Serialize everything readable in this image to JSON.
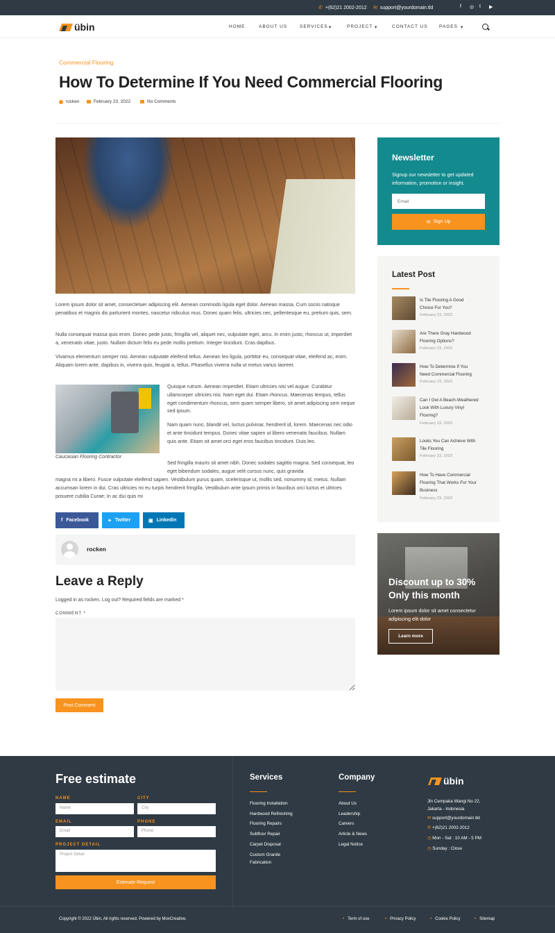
{
  "topbar": {
    "phone": "+(62)21 2002-2012",
    "email": "support@yourdomain.tld",
    "social": [
      "f",
      "◎",
      "t",
      "▶"
    ]
  },
  "nav": {
    "logo": "übin",
    "items": [
      "HOME",
      "ABOUT US",
      "SERVICES",
      "PROJECT",
      "CONTACT US",
      "PAGES"
    ]
  },
  "post": {
    "category": "Commercial Flooring",
    "title": "How To Determine If You Need Commercial Flooring",
    "author": "rocken",
    "date": "February 23, 2022",
    "comments": "No Comments",
    "p1": "Lorem ipsum dolor sit amet, consectetuer adipiscing elit. Aenean commodo ligula eget dolor. Aenean massa. Cum sociis natoque penatibus et magnis dis parturient montes, nascetur ridiculus mus. Donec quam felis, ultricies nec, pellentesque eu, pretium quis, sem.",
    "p2": "Nulla consequat massa quis enim. Donec pede justo, fringilla vel, aliquet nec, vulputate eget, arcu. In enim justo, rhoncus ut, imperdiet a, venenatis vitae, justo. Nullam dictum felis eu pede mollis pretium. Integer tincidunt. Cras dapibus.",
    "p3": "Vivamus elementum semper nisi. Aenean vulputate eleifend tellus. Aenean leo ligula, porttitor eu, consequat vitae, eleifend ac, enim. Aliquam lorem ante, dapibus in, viverra quis, feugiat a, tellus. Phasellus viverra nulla ut metus varius laoreet.",
    "p4": "Quisque rutrum. Aenean imperdiet. Etiam ultricies nisi vel augue. Curabitur ullamcorper ultricies nisi. Nam eget dui. Etiam rhoncus. Maecenas tempus, tellus eget condimentum rhoncus, sem quam semper libero, sit amet adipiscing sem neque sed ipsum.",
    "p5": "Nam quam nunc, blandit vel, luctus pulvinar, hendrerit id, lorem. Maecenas nec odio et ante tincidunt tempus. Donec vitae sapien ut libero venenatis faucibus. Nullam quis ante. Etiam sit amet orci eget eros faucibus tincidunt. Duis leo.",
    "p6a": "Sed fringilla mauris sit amet nibh. Donec sodales sagittis magna. Sed consequat, leo eget bibendum sodales, augue velit cursus nunc, quis gravida",
    "p6b": "magna mi a libero. Fusce vulputate eleifend sapien. Vestibulum purus quam, scelerisque ut, mollis sed, nonummy id, metus. Nullam accumsan lorem in dui. Cras ultricies mi eu turpis hendrerit fringilla. Vestibulum ante ipsum primis in faucibus orci luctus et ultrices posuere cubilia Curae; In ac dui quis mi",
    "caption": "Caucasian Flooring Contractor"
  },
  "share": {
    "facebook": "Facebook",
    "twitter": "Twitter",
    "linkedin": "Linkedin"
  },
  "author_box": {
    "name": "rocken"
  },
  "reply": {
    "heading": "Leave a Reply",
    "logged": "Logged in as rocken. Log out? Required fields are marked *",
    "comment_label": "COMMENT *",
    "submit": "Post Comment"
  },
  "newsletter": {
    "title": "Newsletter",
    "text1": "Signup our newsletter to get updated",
    "text2": "information, promotion or insight.",
    "placeholder": "Email",
    "button": "Sign Up"
  },
  "latest": {
    "title": "Latest Post",
    "items": [
      {
        "l1": "Is Tile Flooring A Good",
        "l2": "Choice For You?",
        "l3": "",
        "date": "February 23, 2022"
      },
      {
        "l1": "Are There Gray Hardwood",
        "l2": "Flooring Options?",
        "l3": "",
        "date": "February 23, 2022"
      },
      {
        "l1": "How To Determine If You",
        "l2": "Need Commercial Flooring",
        "l3": "",
        "date": "February 23, 2022"
      },
      {
        "l1": "Can I Get A Beach-Weathered",
        "l2": "Look With Luxury Vinyl",
        "l3": "Flooring?",
        "date": "February 23, 2022"
      },
      {
        "l1": "Looks You Can Achieve With",
        "l2": "Tile Flooring",
        "l3": "",
        "date": "February 23, 2022"
      },
      {
        "l1": "How To Have Commercial",
        "l2": "Flooring That Works For Your",
        "l3": "Business",
        "date": "February 23, 2022"
      }
    ]
  },
  "promo": {
    "h1": "Discount up to 30%",
    "h2": "Only this month",
    "t1": "Lorem ipsum dolor sit amet consectetur",
    "t2": "adipiscing elit dolor",
    "button": "Learn more"
  },
  "footer": {
    "estimate": {
      "title": "Free estimate",
      "name": "NAME",
      "city": "CITY",
      "email": "EMAIL",
      "phone": "PHONE",
      "detail": "PROJECT DETAIL",
      "ph_name": "Name",
      "ph_city": "City",
      "ph_email": "Email",
      "ph_phone": "Phone",
      "ph_detail": "Project Detail",
      "button": "Estimate Request"
    },
    "services": {
      "title": "Services",
      "items": [
        "Flooring Installation",
        "Hardwood Refinishing",
        "Flooring Repairs",
        "Subfloor Repair",
        "Carpet Disposal",
        "Custom Granite",
        "Fabrication"
      ]
    },
    "company": {
      "title": "Company",
      "items": [
        "About Us",
        "Leadership",
        "Careers",
        "Article & News",
        "Legal Notice"
      ]
    },
    "contact": {
      "logo": "übin",
      "addr1": "Jln Cempaka Wangi No 22,",
      "addr2": "Jakarta - Indonesia",
      "email": "support@yourdomain.tld",
      "phone": "+(62)21 2002-2012",
      "hours1": "Mon - Sat : 10 AM - 5 PM",
      "hours2": "Sunday : Close"
    },
    "copyright": "Copyright © 2022 Übin, All rights reserved. Powered by MoxCreative.",
    "links": [
      "Term of use",
      "Privacy Policy",
      "Cookie Policy",
      "Sitemap"
    ]
  },
  "colors": {
    "accent": "#f7931e",
    "dark": "#2f3a44",
    "teal": "#138a8e"
  }
}
